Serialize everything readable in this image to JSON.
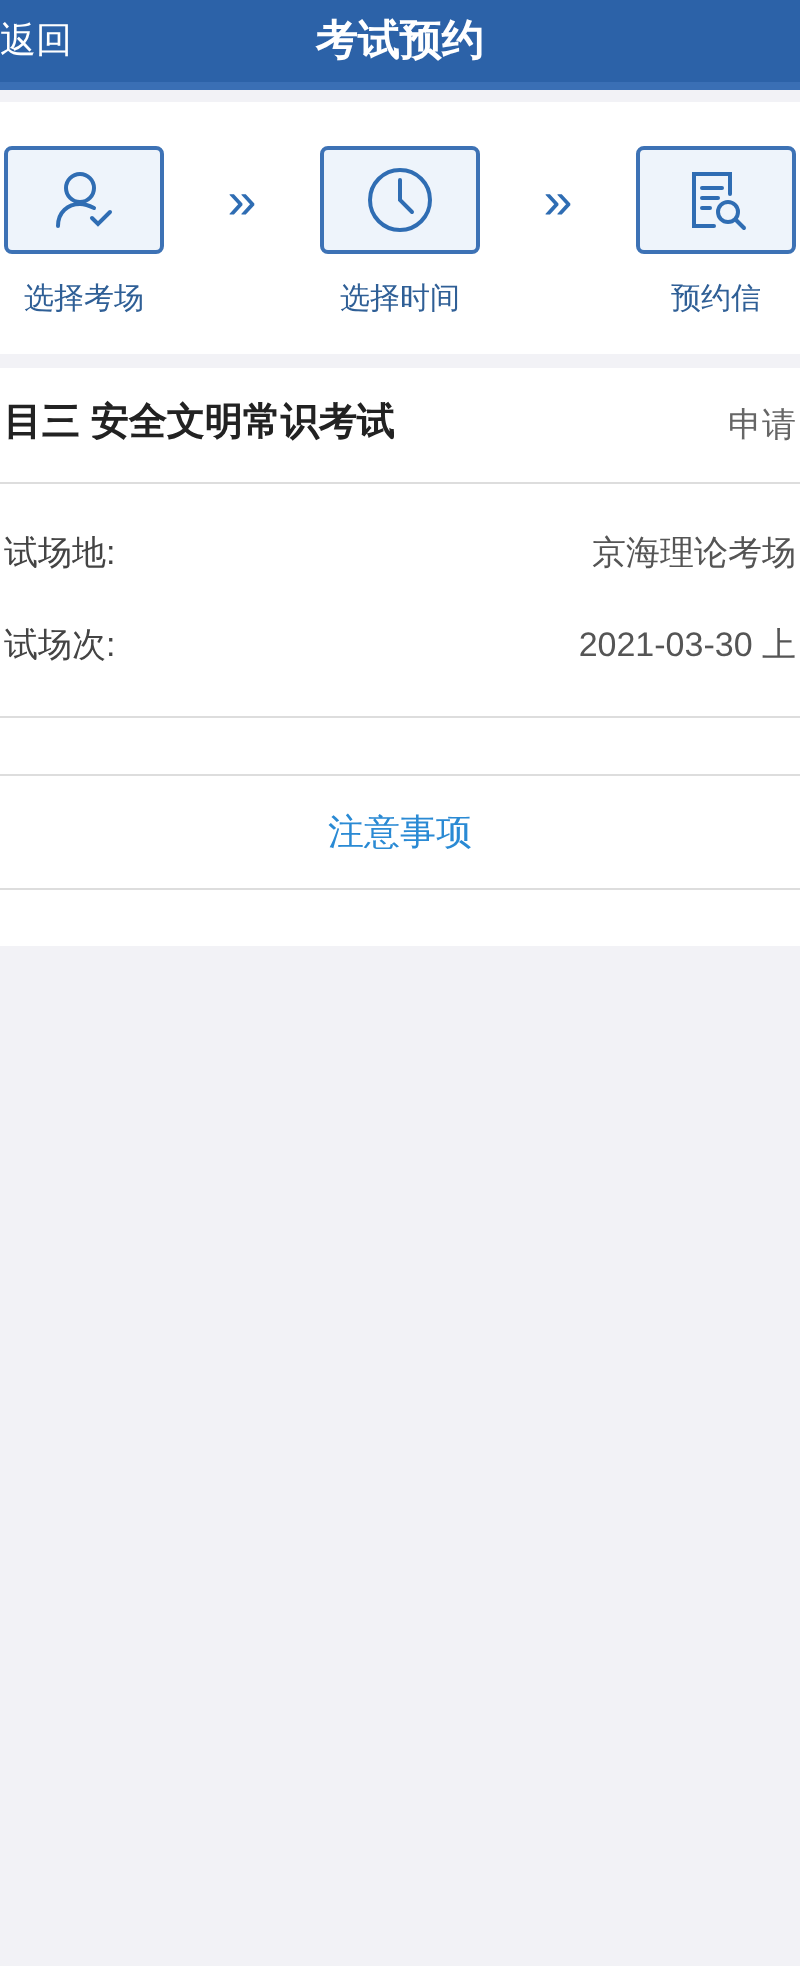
{
  "header": {
    "back": "返回",
    "title": "考试预约"
  },
  "steps": [
    {
      "label": "选择考场",
      "kind": "person"
    },
    {
      "label": "选择时间",
      "kind": "clock"
    },
    {
      "label": "预约信",
      "kind": "document"
    }
  ],
  "separator": "»",
  "exam": {
    "title": "目三 安全文明常识考试",
    "status": "申请",
    "fields": [
      {
        "label": "试场地:",
        "value": "京海理论考场"
      },
      {
        "label": "试场次:",
        "value": "2021-03-30 上"
      }
    ]
  },
  "notice_link": "注意事项"
}
